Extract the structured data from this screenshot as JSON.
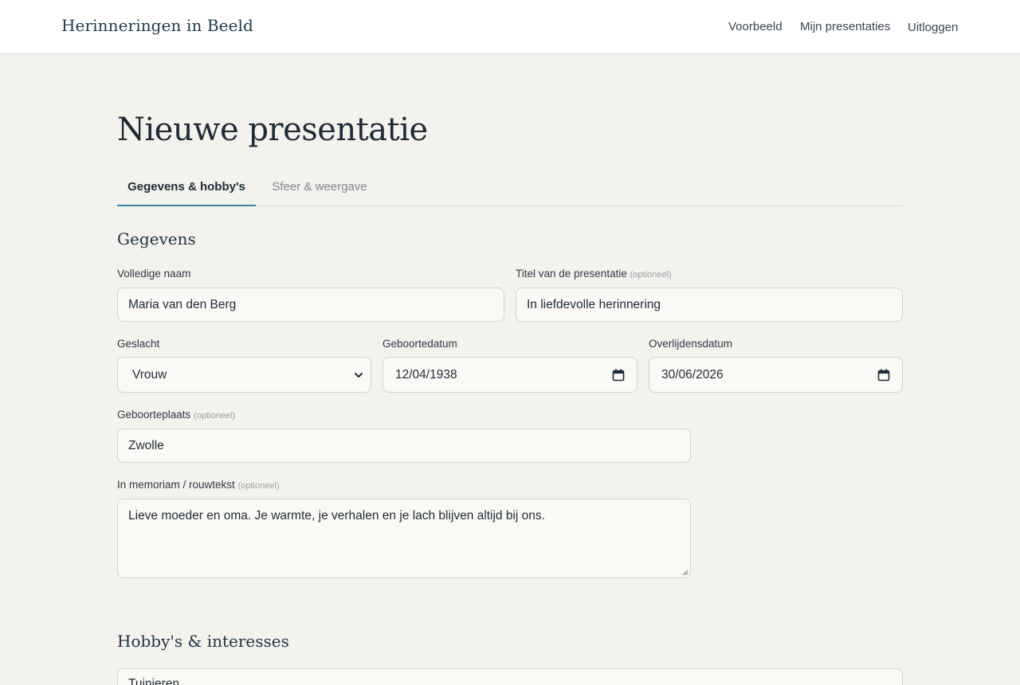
{
  "header": {
    "brand": "Herinneringen in Beeld",
    "nav": [
      "Voorbeeld",
      "Mijn presentaties",
      "Uitloggen"
    ]
  },
  "page": {
    "title": "Nieuwe presentatie",
    "tabs": [
      {
        "label": "Gegevens & hobby's",
        "active": true
      },
      {
        "label": "Sfeer & weergave",
        "active": false
      }
    ]
  },
  "gegevens": {
    "heading": "Gegevens",
    "optional_tag": "(optioneel)",
    "full_name": {
      "label": "Volledige naam",
      "value": "Maria van den Berg"
    },
    "title": {
      "label": "Titel van de presentatie",
      "value": "In liefdevolle herinnering"
    },
    "gender": {
      "label": "Geslacht",
      "value": "Vrouw"
    },
    "birth_date": {
      "label": "Geboortedatum",
      "value": "12/04/1938"
    },
    "death_date": {
      "label": "Overlijdensdatum",
      "value": "30/06/2026"
    },
    "birth_place": {
      "label": "Geboorteplaats",
      "value": "Zwolle"
    },
    "memoriam": {
      "label": "In memoriam / rouwtekst",
      "value": "Lieve moeder en oma. Je warmte, je verhalen en je lach blijven altijd bij ons."
    }
  },
  "hobbies": {
    "heading": "Hobby's & interesses",
    "first_value": "Tuinieren"
  },
  "colors": {
    "background": "#f4f2ed",
    "accent": "#3b86a8",
    "field_bg": "#fbf9f5"
  }
}
